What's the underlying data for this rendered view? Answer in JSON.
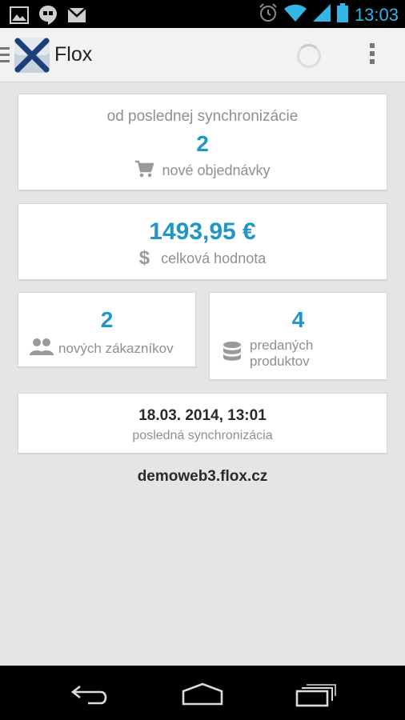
{
  "status_bar": {
    "time": "13:03",
    "icons": [
      "gallery-icon",
      "hangouts-icon",
      "gmail-icon",
      "alarm-icon",
      "wifi-icon",
      "signal-icon",
      "battery-icon"
    ]
  },
  "action_bar": {
    "title": "Flox",
    "icons": [
      "navigation-drawer-icon",
      "flox-logo",
      "loading-spinner",
      "overflow-menu-icon"
    ]
  },
  "cards": {
    "orders": {
      "caption": "od poslednej synchronizácie",
      "value": "2",
      "label": "nové objednávky",
      "icon": "cart-icon"
    },
    "total": {
      "value": "1493,95 €",
      "label": "celková hodnota",
      "icon": "dollar-icon"
    },
    "customers": {
      "value": "2",
      "label": "nových zákazníkov",
      "icon": "users-icon"
    },
    "products": {
      "value": "4",
      "label_line1": "predaných",
      "label_line2": "produktov",
      "icon": "database-icon"
    },
    "sync": {
      "datetime": "18.03. 2014, 13:01",
      "label": "posledná synchronizácia"
    }
  },
  "footer": {
    "domain": "demoweb3.flox.cz"
  },
  "nav_bar": {
    "icons": [
      "back-icon",
      "home-icon",
      "recent-apps-icon"
    ]
  },
  "colors": {
    "accent": "#1f96c9",
    "status_blue": "#33b5e5",
    "background": "#e5e5e5"
  }
}
